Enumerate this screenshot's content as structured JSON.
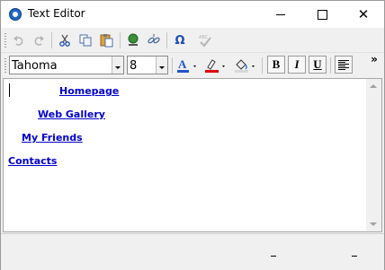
{
  "window": {
    "title": "Text Editor",
    "controls": {
      "close_glyph": "✕"
    }
  },
  "toolbar1": {
    "icons": [
      "undo-icon",
      "redo-icon",
      "cut-icon",
      "copy-icon",
      "paste-icon",
      "insert-link-icon",
      "remove-link-icon",
      "special-character-icon",
      "spellcheck-icon"
    ],
    "symbol_glyph": "Ω"
  },
  "toolbar2": {
    "font_family": "Tahoma",
    "font_size": "8",
    "font_color_glyph": "A",
    "font_color": "#2155c8",
    "highlight_color": "#e00000",
    "bold_label": "B",
    "italic_label": "I",
    "underline_label": "U",
    "overflow_glyph": "»"
  },
  "editor": {
    "links": [
      {
        "text": "Homepage"
      },
      {
        "text": "Web Gallery"
      },
      {
        "text": "My Friends"
      },
      {
        "text": "Contacts"
      }
    ]
  }
}
